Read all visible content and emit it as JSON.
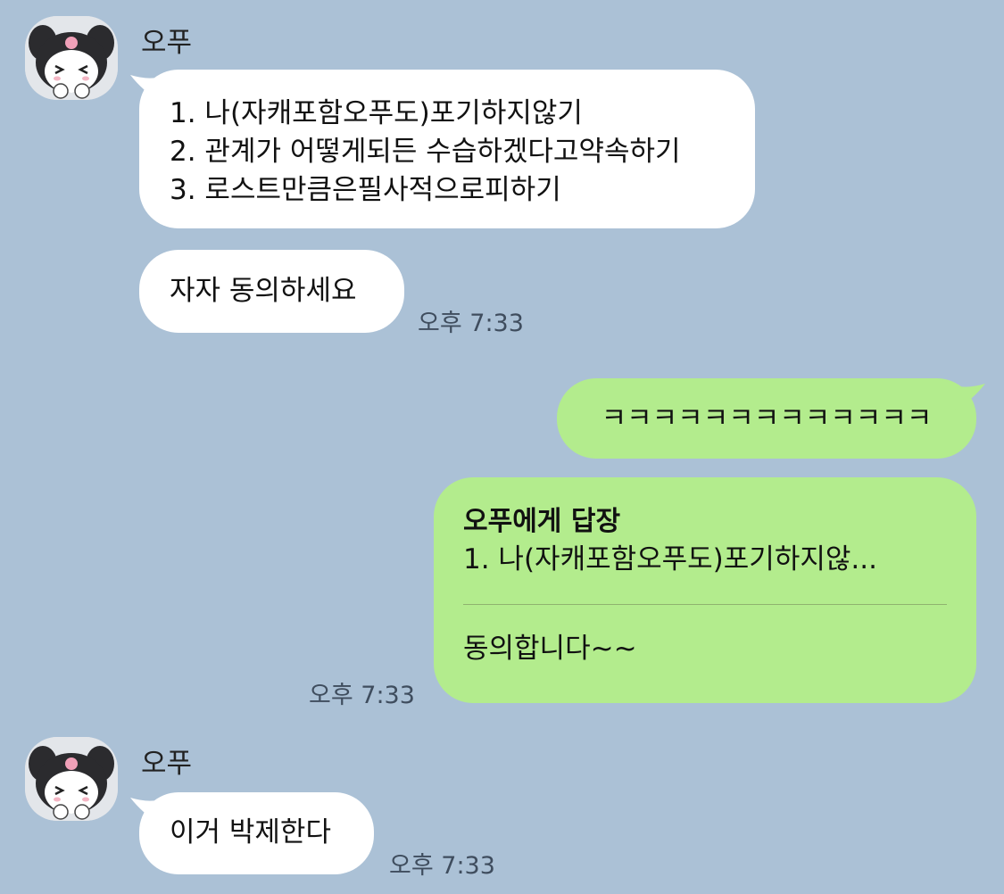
{
  "messages": {
    "m1": {
      "sender": "오푸",
      "lines": [
        "1. 나(자캐포함오푸도)포기하지않기",
        "2. 관계가 어떻게되든 수습하겠다고약속하기",
        "3. 로스트만큼은필사적으로피하기"
      ]
    },
    "m2": {
      "text": "자자 동의하세요",
      "time": "오후 7:33"
    },
    "m3": {
      "text": "ㅋㅋㅋㅋㅋㅋㅋㅋㅋㅋㅋㅋㅋ"
    },
    "m4": {
      "reply_to": "오푸에게 답장",
      "quote": "1. 나(자캐포함오푸도)포기하지않...",
      "text": "동의합니다~~",
      "time": "오후 7:33"
    },
    "m5": {
      "sender": "오푸",
      "text": "이거 박제한다",
      "time": "오후 7:33"
    }
  },
  "colors": {
    "background": "#abc1d6",
    "bubble_incoming": "#ffffff",
    "bubble_outgoing": "#b3ec8d"
  },
  "icons": {
    "avatar": "kuromi-avatar"
  }
}
